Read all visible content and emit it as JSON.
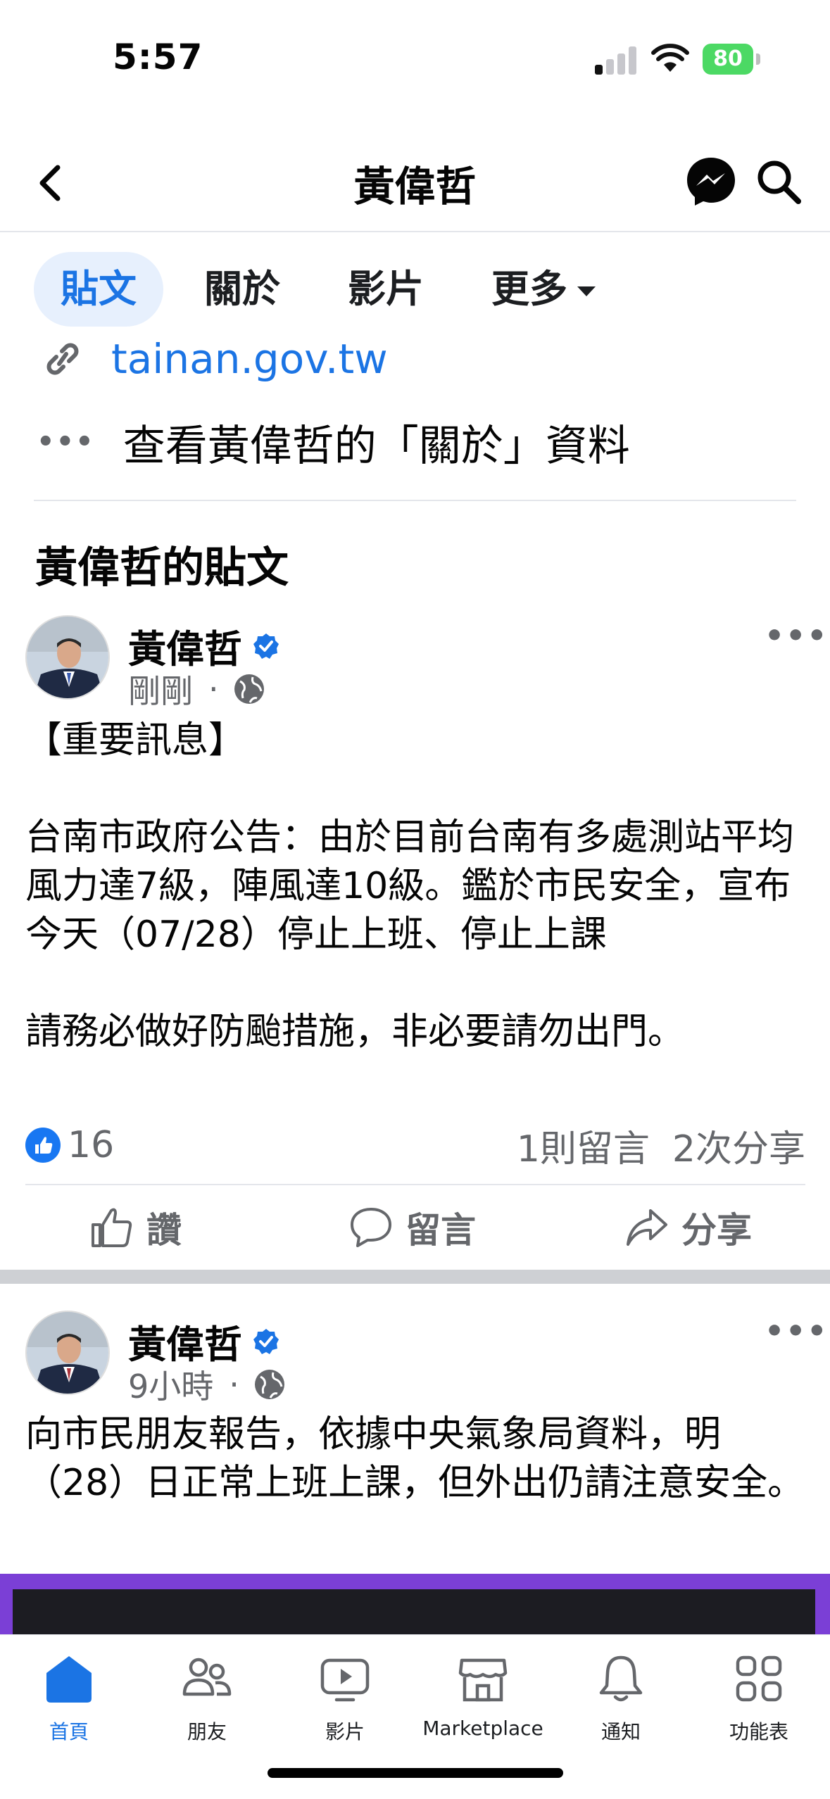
{
  "status_bar": {
    "time": "5:57",
    "battery": "80"
  },
  "header": {
    "title": "黃偉哲"
  },
  "tabs": [
    {
      "label": "貼文"
    },
    {
      "label": "關於"
    },
    {
      "label": "影片"
    },
    {
      "label": "更多"
    }
  ],
  "about": {
    "link": "tainan.gov.tw",
    "see_about": "查看黃偉哲的「關於」資料"
  },
  "section_title": "黃偉哲的貼文",
  "posts": [
    {
      "author": "黃偉哲",
      "time": "剛剛",
      "dot": "·",
      "text": "【重要訊息】\n\n台南市政府公告：由於目前台南有多處測站平均風力達7級，陣風達10級。鑑於市民安全，宣布今天（07/28）停止上班、停止上課\n\n請務必做好防颱措施，非必要請勿出門。",
      "likes": "16",
      "comments": "1則留言",
      "shares": "2次分享",
      "actions": {
        "like": "讚",
        "comment": "留言",
        "share": "分享"
      }
    },
    {
      "author": "黃偉哲",
      "time": "9小時",
      "dot": "·",
      "text": "向市民朋友報告，依據中央氣象局資料，明（28）日正常上班上課，但外出仍請注意安全。"
    }
  ],
  "bottom_nav": [
    {
      "label": "首頁",
      "icon": "home-icon"
    },
    {
      "label": "朋友",
      "icon": "friends-icon"
    },
    {
      "label": "影片",
      "icon": "video-icon"
    },
    {
      "label": "Marketplace",
      "icon": "marketplace-icon"
    },
    {
      "label": "通知",
      "icon": "bell-icon"
    },
    {
      "label": "功能表",
      "icon": "menu-grid-icon"
    }
  ],
  "colors": {
    "accent": "#1b74e4",
    "tab_active_bg": "#e7f0fd",
    "secondary_text": "#65676b"
  }
}
